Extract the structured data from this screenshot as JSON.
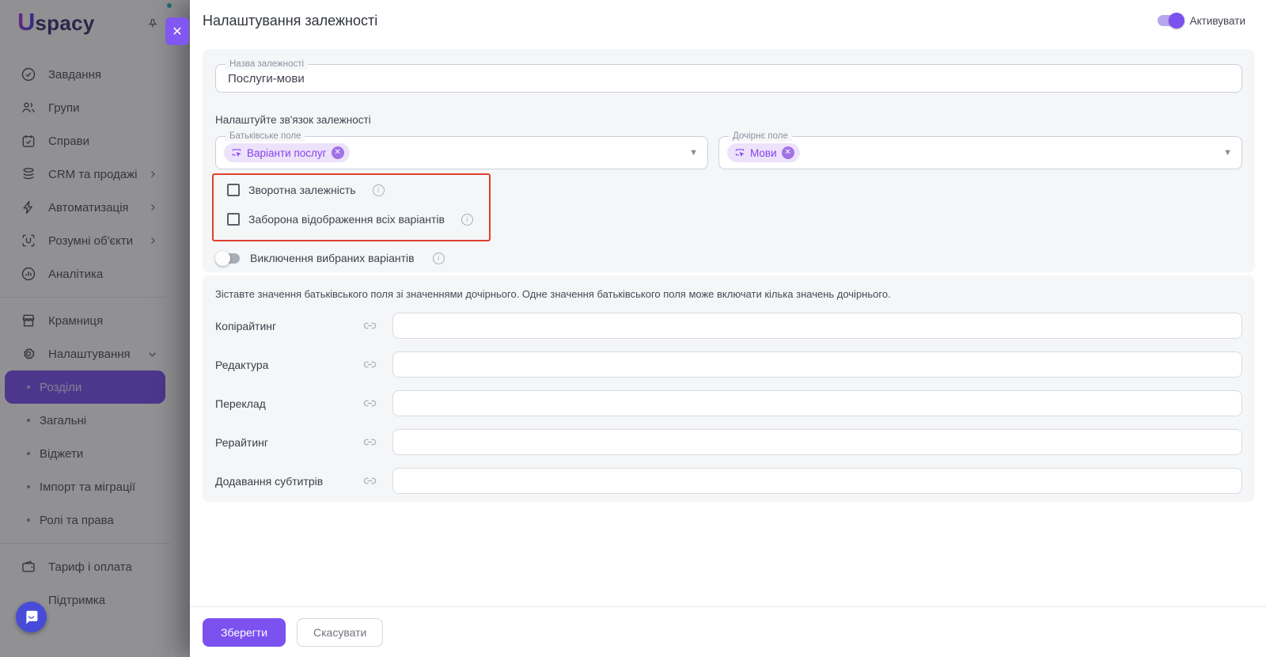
{
  "brand": {
    "logo_u": "U",
    "logo_rest": "spacy"
  },
  "colors": {
    "accent": "#7b51f0",
    "chip_bg": "#ede2fb",
    "chip_text": "#8644ee",
    "highlight_border": "#df422d",
    "card_bg": "#f5f6f8",
    "fab_bg": "#474bd8"
  },
  "sidebar": {
    "items": [
      {
        "label": "Завдання"
      },
      {
        "label": "Групи"
      },
      {
        "label": "Справи"
      },
      {
        "label": "CRM та продажі",
        "chevron": "right"
      },
      {
        "label": "Автоматизація",
        "chevron": "right"
      },
      {
        "label": "Розумні об'єкти",
        "chevron": "right"
      },
      {
        "label": "Аналітика"
      },
      {
        "label": "Крамниця"
      },
      {
        "label": "Налаштування",
        "chevron": "down"
      }
    ],
    "settings_subitems": [
      {
        "label": "Розділи",
        "selected": true
      },
      {
        "label": "Загальні"
      },
      {
        "label": "Віджети"
      },
      {
        "label": "Імпорт та міграції"
      },
      {
        "label": "Ролі та права"
      }
    ],
    "bottom_items": [
      {
        "label": "Тариф і оплата"
      },
      {
        "label": "Підтримка"
      }
    ]
  },
  "modal": {
    "title": "Налаштування залежності",
    "activate_label": "Активувати",
    "activate_on": true,
    "close_icon": "✕",
    "name_field": {
      "label": "Назва залежності",
      "value": "Послуги-мови"
    },
    "relation": {
      "section_label": "Налаштуйте зв'язок залежності",
      "parent_field": {
        "label": "Батьківське поле",
        "chip": "Варіанти послуг",
        "chip_remove": "✕"
      },
      "child_field": {
        "label": "Дочірнє поле",
        "chip": "Мови",
        "chip_remove": "✕"
      },
      "caret": "▼"
    },
    "options": {
      "checkbox_reverse": {
        "label": "Зворотна залежність",
        "checked": false
      },
      "checkbox_forbid": {
        "label": "Заборона відображення всіх варіантів",
        "checked": false
      },
      "toggle_exclude": {
        "label": "Виключення вибраних варіантів",
        "on": false
      },
      "info_glyph": "i"
    },
    "mapping": {
      "instruction": "Зіставте значення батьківського поля зі значеннями дочірнього. Одне значення батьківського поля може включати кілька значень дочірнього.",
      "rows": [
        {
          "label": "Копірайтинг",
          "value": ""
        },
        {
          "label": "Редактура",
          "value": ""
        },
        {
          "label": "Переклад",
          "value": ""
        },
        {
          "label": "Рерайтинг",
          "value": ""
        },
        {
          "label": "Додавання субтитрів",
          "value": ""
        }
      ]
    },
    "footer": {
      "save": "Зберегти",
      "cancel": "Скасувати"
    }
  }
}
